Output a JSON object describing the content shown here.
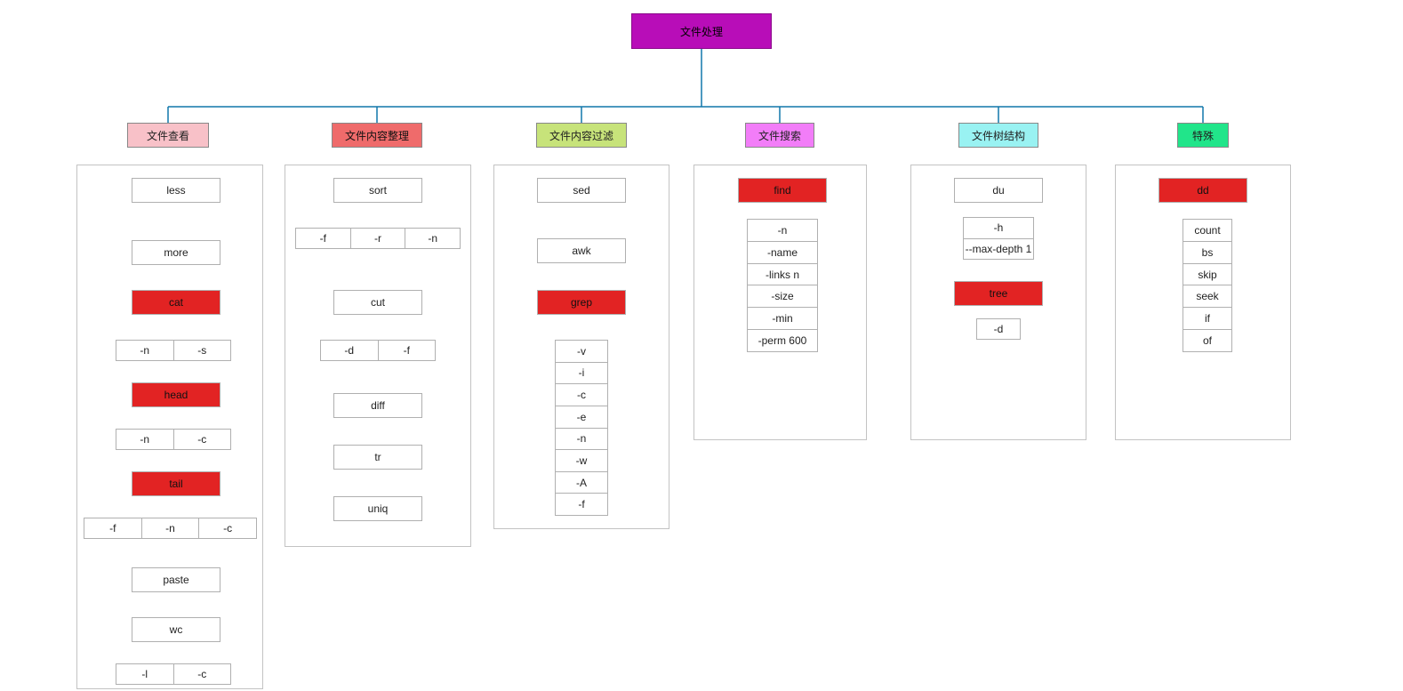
{
  "root": {
    "label": "文件处理"
  },
  "categories": {
    "c0": {
      "label": "文件查看"
    },
    "c1": {
      "label": "文件内容整理"
    },
    "c2": {
      "label": "文件内容过滤"
    },
    "c3": {
      "label": "文件搜索"
    },
    "c4": {
      "label": "文件树结构"
    },
    "c5": {
      "label": "特殊"
    }
  },
  "cmds": {
    "less": "less",
    "more": "more",
    "cat": "cat",
    "head": "head",
    "tail": "tail",
    "paste": "paste",
    "wc": "wc",
    "sort": "sort",
    "cut": "cut",
    "diff": "diff",
    "tr": "tr",
    "uniq": "uniq",
    "sed": "sed",
    "awk": "awk",
    "grep": "grep",
    "find": "find",
    "du": "du",
    "tree": "tree",
    "dd": "dd"
  },
  "opts": {
    "cat": [
      "-n",
      "-s"
    ],
    "head": [
      "-n",
      "-c"
    ],
    "tail": [
      "-f",
      "-n",
      "-c"
    ],
    "wc": [
      "-l",
      "-c"
    ],
    "sort": [
      "-f",
      "-r",
      "-n"
    ],
    "cut": [
      "-d",
      "-f"
    ],
    "grep": [
      "-v",
      "-i",
      "-c",
      "-e",
      "-n",
      "-w",
      "-A",
      "-f"
    ],
    "find": [
      "-n",
      "-name",
      "-links n",
      "-size",
      "-min",
      "-perm 600"
    ],
    "du": [
      "-h",
      "--max-depth 1"
    ],
    "tree": [
      "-d"
    ],
    "dd": [
      "count",
      "bs",
      "skip",
      "seek",
      "if",
      "of"
    ]
  }
}
